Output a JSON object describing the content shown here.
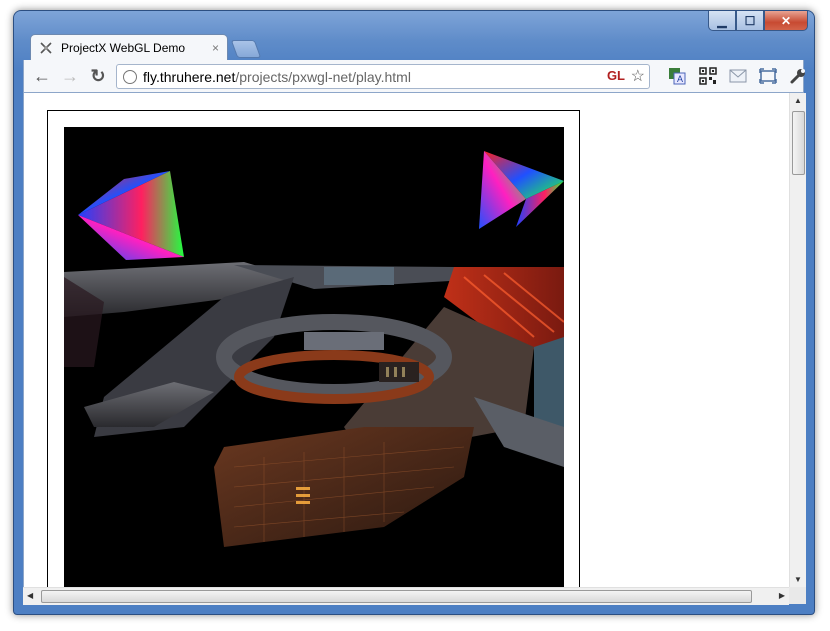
{
  "window": {
    "controls": {
      "minimize": "▁",
      "maximize": "☐",
      "close": "✕"
    }
  },
  "tab": {
    "title": "ProjectX WebGL Demo",
    "close": "×"
  },
  "toolbar": {
    "back": "←",
    "forward": "→",
    "reload": "↻",
    "url_host": "fly.thruhere.net",
    "url_path": "/projects/pxwgl-net/play.html",
    "gl_badge": "GL",
    "star": "☆"
  },
  "extensions": [
    "translate-icon",
    "qr-code-icon",
    "mail-icon",
    "fullscreen-icon",
    "wrench-icon"
  ],
  "page": {
    "canvas_label": "WebGL render canvas"
  },
  "colors": {
    "frame": "#4d7fc3",
    "canvas_bg": "#000000",
    "gl_badge": "#b12020"
  }
}
